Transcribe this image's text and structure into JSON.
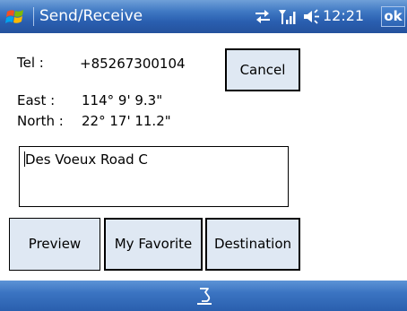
{
  "window": {
    "title": "Send/Receive",
    "clock": "12:21",
    "ok_label": "ok",
    "start_icon": "windows-flag-icon",
    "status_icons": [
      "sync-arrows-icon",
      "signal-strength-icon",
      "speaker-volume-icon"
    ]
  },
  "details": {
    "tel_label": "Tel :",
    "tel_value": "+85267300104",
    "east_label": "East :",
    "east_value": "114° 9' 9.3\"",
    "north_label": "North :",
    "north_value": "22° 17' 11.2\""
  },
  "address": {
    "value": "Des Voeux Road C"
  },
  "buttons": {
    "cancel": "Cancel",
    "preview": "Preview",
    "my_favorite": "My Favorite",
    "destination": "Destination"
  },
  "menubar": {
    "sip_icon": "keyboard-input-panel-icon"
  },
  "colors": {
    "titlebar": "#3f78c3",
    "button_face": "#dfe8f3",
    "menubar": "#3b74c2"
  }
}
